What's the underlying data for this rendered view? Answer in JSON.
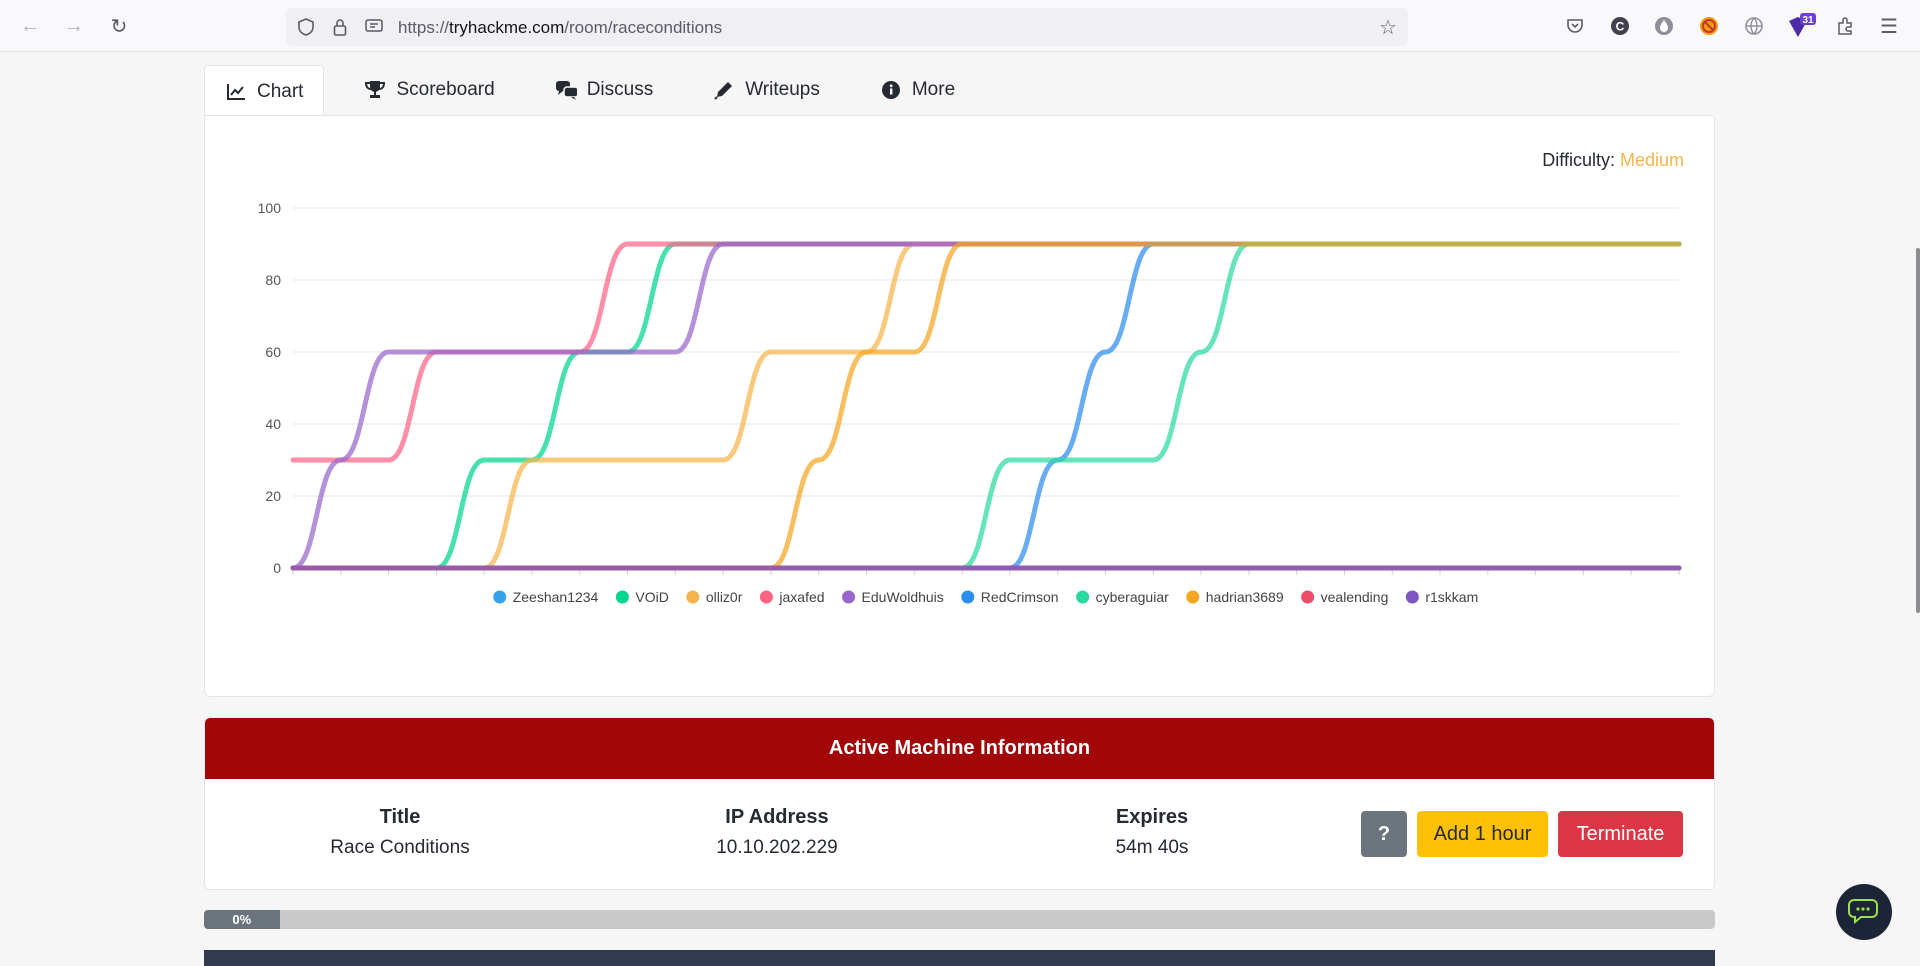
{
  "browser": {
    "url_prefix": "https://",
    "url_host": "tryhackme.com",
    "url_path": "/room/raceconditions",
    "badge_count": "31"
  },
  "tabs": [
    {
      "label": "Chart",
      "icon": "chart-line-icon",
      "active": true
    },
    {
      "label": "Scoreboard",
      "icon": "trophy-icon",
      "active": false
    },
    {
      "label": "Discuss",
      "icon": "comments-icon",
      "active": false
    },
    {
      "label": "Writeups",
      "icon": "pen-icon",
      "active": false
    },
    {
      "label": "More",
      "icon": "info-icon",
      "active": false
    }
  ],
  "difficulty": {
    "label": "Difficulty:",
    "level": "Medium"
  },
  "chart_data": {
    "type": "line",
    "ylim": [
      0,
      100
    ],
    "yticks": [
      "0",
      "20",
      "40",
      "60",
      "80",
      "100"
    ],
    "x": [
      0,
      1,
      2,
      3,
      4,
      5,
      6,
      7,
      8,
      9,
      10,
      11,
      12,
      13,
      14,
      15,
      16,
      17,
      18,
      19,
      20,
      21,
      22,
      23,
      24,
      25,
      26,
      27,
      28,
      29
    ],
    "legend_position": "bottom",
    "grid": true,
    "series": [
      {
        "name": "Zeeshan1234",
        "color": "#36a2eb",
        "values": [
          0,
          0,
          0,
          0,
          0,
          0,
          0,
          0,
          0,
          0,
          0,
          0,
          0,
          0,
          0,
          0,
          0,
          0,
          0,
          0,
          0,
          0,
          0,
          0,
          0,
          0,
          0,
          0,
          0,
          0
        ]
      },
      {
        "name": "VOiD",
        "color": "#00d68f",
        "values": [
          0,
          0,
          0,
          0,
          30,
          30,
          60,
          60,
          90,
          90,
          90,
          90,
          90,
          90,
          90,
          90,
          90,
          90,
          90,
          90,
          90,
          90,
          90,
          90,
          90,
          90,
          90,
          90,
          90,
          90
        ]
      },
      {
        "name": "olliz0r",
        "color": "#f6b54c",
        "values": [
          0,
          0,
          0,
          0,
          0,
          30,
          30,
          30,
          30,
          30,
          60,
          60,
          60,
          90,
          90,
          90,
          90,
          90,
          90,
          90,
          90,
          90,
          90,
          90,
          90,
          90,
          90,
          90,
          90,
          90
        ]
      },
      {
        "name": "jaxafed",
        "color": "#ff6384",
        "values": [
          30,
          30,
          30,
          60,
          60,
          60,
          60,
          90,
          90,
          90,
          90,
          90,
          90,
          90,
          90,
          90,
          90,
          90,
          90,
          90,
          90,
          90,
          90,
          90,
          90,
          90,
          90,
          90,
          90,
          90
        ]
      },
      {
        "name": "EduWoldhuis",
        "color": "#9966cc",
        "values": [
          0,
          30,
          60,
          60,
          60,
          60,
          60,
          60,
          60,
          90,
          90,
          90,
          90,
          90,
          90,
          90,
          90,
          90,
          90,
          90,
          90,
          90,
          90,
          90,
          90,
          90,
          90,
          90,
          90,
          90
        ]
      },
      {
        "name": "RedCrimson",
        "color": "#2e8ef0",
        "values": [
          0,
          0,
          0,
          0,
          0,
          0,
          0,
          0,
          0,
          0,
          0,
          0,
          0,
          0,
          0,
          0,
          30,
          60,
          90,
          90,
          90,
          90,
          90,
          90,
          90,
          90,
          90,
          90,
          90,
          90
        ]
      },
      {
        "name": "cyberaguiar",
        "color": "#2bd9a0",
        "values": [
          0,
          0,
          0,
          0,
          0,
          0,
          0,
          0,
          0,
          0,
          0,
          0,
          0,
          0,
          0,
          30,
          30,
          30,
          30,
          60,
          90,
          90,
          90,
          90,
          90,
          90,
          90,
          90,
          90,
          90
        ]
      },
      {
        "name": "hadrian3689",
        "color": "#f5a623",
        "values": [
          0,
          0,
          0,
          0,
          0,
          0,
          0,
          0,
          0,
          0,
          0,
          30,
          60,
          60,
          90,
          90,
          90,
          90,
          90,
          90,
          90,
          90,
          90,
          90,
          90,
          90,
          90,
          90,
          90,
          90
        ]
      },
      {
        "name": "vealending",
        "color": "#ee4d6a",
        "values": [
          0,
          0,
          0,
          0,
          0,
          0,
          0,
          0,
          0,
          0,
          0,
          0,
          0,
          0,
          0,
          0,
          0,
          0,
          0,
          0,
          0,
          0,
          0,
          0,
          0,
          0,
          0,
          0,
          0,
          0
        ]
      },
      {
        "name": "r1skkam",
        "color": "#7e57c2",
        "values": [
          0,
          0,
          0,
          0,
          0,
          0,
          0,
          0,
          0,
          0,
          0,
          0,
          0,
          0,
          0,
          0,
          0,
          0,
          0,
          0,
          0,
          0,
          0,
          0,
          0,
          0,
          0,
          0,
          0,
          0
        ]
      }
    ]
  },
  "machine": {
    "header": "Active Machine Information",
    "title_label": "Title",
    "title_value": "Race Conditions",
    "ip_label": "IP Address",
    "ip_value": "10.10.202.229",
    "expires_label": "Expires",
    "expires_value": "54m 40s",
    "help_label": "?",
    "add_label": "Add 1 hour",
    "terminate_label": "Terminate"
  },
  "progress": {
    "label": "0%",
    "value": 0
  }
}
